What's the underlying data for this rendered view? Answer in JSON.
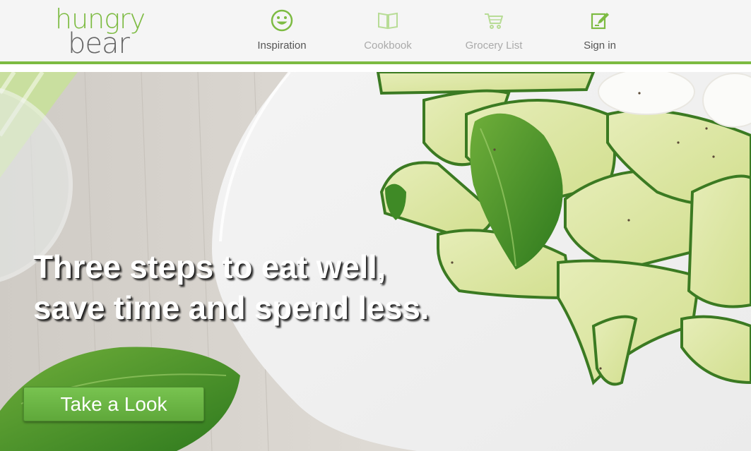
{
  "brand": {
    "logo_top": "hungry",
    "logo_bottom": "bear",
    "green": "#7dbb42",
    "grey": "#666666"
  },
  "nav": {
    "items": [
      {
        "label": "Inspiration",
        "icon": "smiley-face-icon",
        "state": "active",
        "color": "#555555"
      },
      {
        "label": "Cookbook",
        "icon": "open-book-icon",
        "state": "inactive",
        "color": "#aaaaaa"
      },
      {
        "label": "Grocery List",
        "icon": "shopping-cart-icon",
        "state": "inactive",
        "color": "#aaaaaa"
      },
      {
        "label": "Sign in",
        "icon": "edit-pencil-icon",
        "state": "active",
        "color": "#555555"
      }
    ]
  },
  "hero": {
    "headline_line1": "Three steps to eat well,",
    "headline_line2": "save time and spend less.",
    "cta_label": "Take a Look",
    "image": "zucchini-ribbon-salad-photo"
  }
}
